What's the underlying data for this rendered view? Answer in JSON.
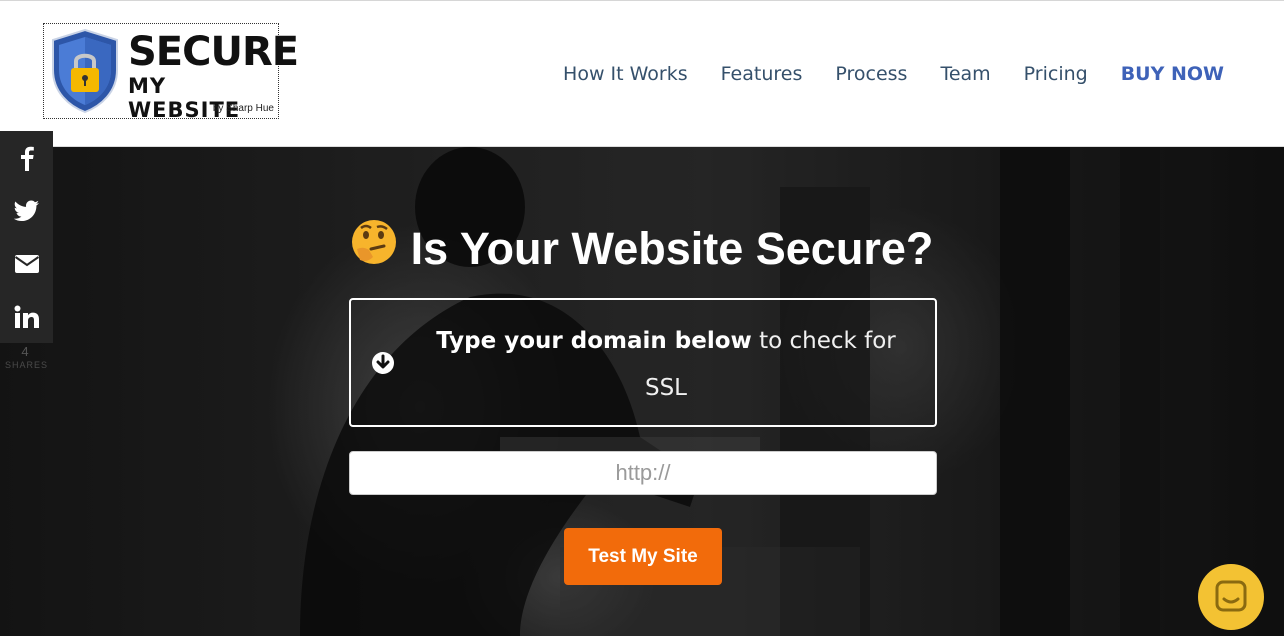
{
  "brand": {
    "line1": "SECURE",
    "line2": "MY WEBSITE",
    "byline": "by Sharp Hue"
  },
  "nav": {
    "items": [
      "How It Works",
      "Features",
      "Process",
      "Team",
      "Pricing"
    ],
    "buy_label": "BUY NOW"
  },
  "hero": {
    "title": "Is Your Website Secure?",
    "info_bold": "Type your domain below",
    "info_rest": " to check for SSL",
    "input_placeholder": "http://",
    "button_label": "Test My Site"
  },
  "share": {
    "networks": [
      "facebook-icon",
      "twitter-icon",
      "email-icon",
      "linkedin-icon"
    ],
    "count": "4",
    "count_label": "SHARES"
  },
  "colors": {
    "accent": "#f26b0b",
    "nav_text": "#35506b",
    "buy_now": "#3e62b8",
    "chat_bubble": "#f3c233"
  }
}
